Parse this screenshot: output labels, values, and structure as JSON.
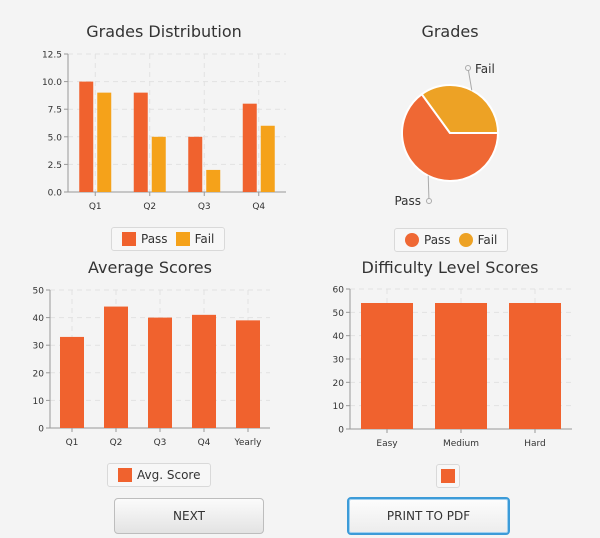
{
  "chart_data": [
    {
      "type": "bar",
      "title": "Grades Distribution",
      "categories": [
        "Q1",
        "Q2",
        "Q3",
        "Q4"
      ],
      "series": [
        {
          "name": "Pass",
          "values": [
            10,
            9,
            5,
            8
          ]
        },
        {
          "name": "Fail",
          "values": [
            9,
            5,
            2,
            6
          ]
        }
      ],
      "ylim": [
        0,
        12.5
      ],
      "yticks": [
        "0.0",
        "2.5",
        "5.0",
        "7.5",
        "10.0",
        "12.5"
      ],
      "grid": true,
      "legend": "bottom"
    },
    {
      "type": "pie",
      "title": "Grades",
      "labels": [
        "Pass",
        "Fail"
      ],
      "values": [
        65,
        35
      ],
      "legend": "bottom"
    },
    {
      "type": "bar",
      "title": "Average Scores",
      "categories": [
        "Q1",
        "Q2",
        "Q3",
        "Q4",
        "Yearly"
      ],
      "series": [
        {
          "name": "Avg. Score",
          "values": [
            33,
            44,
            40,
            41,
            39
          ]
        }
      ],
      "ylim": [
        0,
        50
      ],
      "yticks": [
        "0",
        "10",
        "20",
        "30",
        "40",
        "50"
      ],
      "grid": true,
      "legend": "bottom"
    },
    {
      "type": "bar",
      "title": "Difficulty Level Scores",
      "categories": [
        "Easy",
        "Medium",
        "Hard"
      ],
      "series": [
        {
          "name": "",
          "values": [
            54,
            54,
            54
          ]
        }
      ],
      "ylim": [
        0,
        60
      ],
      "yticks": [
        "0",
        "10",
        "20",
        "30",
        "40",
        "50",
        "60"
      ],
      "grid": true,
      "legend": "bottom"
    }
  ],
  "colors": {
    "series1": "#f0622e",
    "series2": "#f5a21a",
    "pie_pass": "#ef6834",
    "pie_fail": "#eda225",
    "grid": "#e2e2e2",
    "axis": "#999999"
  },
  "buttons": {
    "next": "NEXT",
    "print": "PRINT TO PDF"
  }
}
